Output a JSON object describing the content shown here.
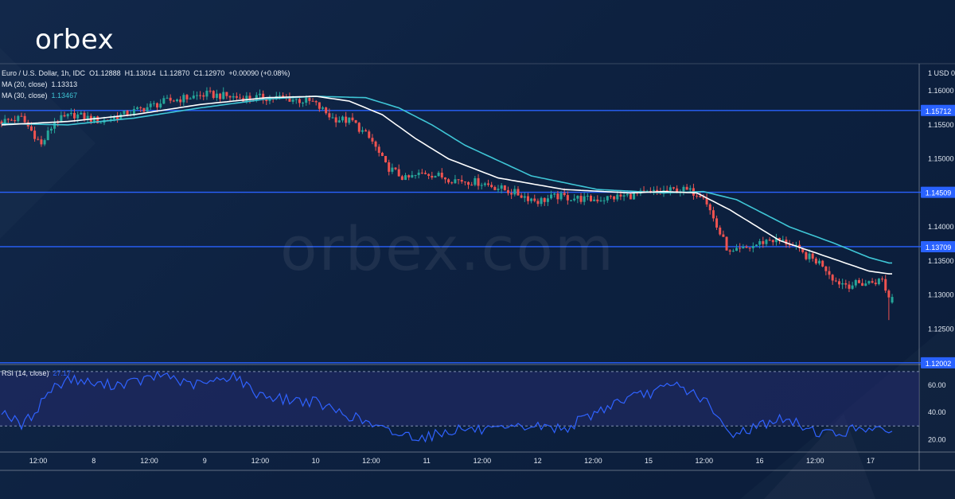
{
  "brand": {
    "logo_text": "orbex",
    "watermark_text": "orbex.com"
  },
  "legend": {
    "symbol_line": "Euro / U.S. Dollar, 1h, IDC",
    "open": "O1.12888",
    "high": "H1.13014",
    "low": "L1.12870",
    "close": "C1.12970",
    "change": "+0.00090 (+0.08%)",
    "ma20_label": "MA (20, close)",
    "ma20_value": "1.13313",
    "ma30_label": "MA (30, close)",
    "ma30_value": "1.13467",
    "rsi_label": "RSI (14, close)",
    "rsi_value": "27.17"
  },
  "colors": {
    "background": "#0e2240",
    "up_candle": "#26a69a",
    "down_candle": "#ef5350",
    "ma20": "#ffffff",
    "ma30": "#3fc6d6",
    "hline": "#2962ff",
    "rsi_line": "#2f62ff",
    "rsi_band": "#252c6e",
    "axis_text": "#dfe6f0"
  },
  "chart_data": {
    "type": "candlestick",
    "title": "Euro / U.S. Dollar, 1h, IDC",
    "currency_label": "1 USD 0",
    "ylim": [
      1.12,
      1.164
    ],
    "yticks": [
      "1.16000",
      "1.15500",
      "1.15000",
      "1.14000",
      "1.13500",
      "1.13000",
      "1.12500"
    ],
    "ytick_values": [
      1.16,
      1.155,
      1.15,
      1.14,
      1.135,
      1.13,
      1.125
    ],
    "xticks": [
      "12:00",
      "8",
      "12:00",
      "9",
      "12:00",
      "10",
      "12:00",
      "11",
      "12:00",
      "12",
      "12:00",
      "15",
      "12:00",
      "16",
      "12:00",
      "17"
    ],
    "horizontal_levels": [
      {
        "label": "1.15712",
        "value": 1.15712
      },
      {
        "label": "1.14509",
        "value": 1.14509
      },
      {
        "label": "1.13709",
        "value": 1.13709
      },
      {
        "label": "1.12002",
        "value": 1.12002
      }
    ],
    "price_anchors": [
      [
        0,
        1.1555
      ],
      [
        6,
        1.156
      ],
      [
        10,
        1.1535
      ],
      [
        12,
        1.152
      ],
      [
        16,
        1.1555
      ],
      [
        22,
        1.1565
      ],
      [
        30,
        1.1555
      ],
      [
        40,
        1.157
      ],
      [
        50,
        1.1585
      ],
      [
        62,
        1.1595
      ],
      [
        72,
        1.159
      ],
      [
        85,
        1.159
      ],
      [
        94,
        1.1583
      ],
      [
        100,
        1.156
      ],
      [
        106,
        1.1555
      ],
      [
        112,
        1.1525
      ],
      [
        116,
        1.149
      ],
      [
        122,
        1.147
      ],
      [
        128,
        1.148
      ],
      [
        136,
        1.147
      ],
      [
        145,
        1.1465
      ],
      [
        155,
        1.145
      ],
      [
        162,
        1.1438
      ],
      [
        168,
        1.1445
      ],
      [
        178,
        1.144
      ],
      [
        188,
        1.1445
      ],
      [
        196,
        1.145
      ],
      [
        205,
        1.1455
      ],
      [
        212,
        1.1448
      ],
      [
        216,
        1.14
      ],
      [
        220,
        1.136
      ],
      [
        226,
        1.137
      ],
      [
        232,
        1.1382
      ],
      [
        238,
        1.1376
      ],
      [
        242,
        1.136
      ],
      [
        248,
        1.1345
      ],
      [
        252,
        1.132
      ],
      [
        256,
        1.1315
      ],
      [
        262,
        1.1318
      ],
      [
        266,
        1.1322
      ],
      [
        268,
        1.1296
      ]
    ],
    "ma20_anchors": [
      [
        0,
        1.155
      ],
      [
        20,
        1.1555
      ],
      [
        40,
        1.1565
      ],
      [
        60,
        1.158
      ],
      [
        80,
        1.159
      ],
      [
        95,
        1.1592
      ],
      [
        105,
        1.1585
      ],
      [
        115,
        1.1565
      ],
      [
        125,
        1.153
      ],
      [
        135,
        1.15
      ],
      [
        150,
        1.1472
      ],
      [
        170,
        1.1455
      ],
      [
        190,
        1.145
      ],
      [
        200,
        1.1452
      ],
      [
        210,
        1.145
      ],
      [
        220,
        1.1425
      ],
      [
        235,
        1.138
      ],
      [
        250,
        1.1355
      ],
      [
        262,
        1.1335
      ],
      [
        268,
        1.1331
      ]
    ],
    "ma30_anchors": [
      [
        0,
        1.1552
      ],
      [
        20,
        1.155
      ],
      [
        40,
        1.156
      ],
      [
        60,
        1.1575
      ],
      [
        80,
        1.1588
      ],
      [
        95,
        1.1592
      ],
      [
        110,
        1.159
      ],
      [
        120,
        1.1575
      ],
      [
        130,
        1.155
      ],
      [
        140,
        1.152
      ],
      [
        160,
        1.1475
      ],
      [
        180,
        1.1455
      ],
      [
        200,
        1.145
      ],
      [
        212,
        1.1452
      ],
      [
        222,
        1.144
      ],
      [
        238,
        1.14
      ],
      [
        252,
        1.1375
      ],
      [
        262,
        1.1355
      ],
      [
        268,
        1.1347
      ]
    ],
    "last_candle": {
      "open": 1.12888,
      "high": 1.13014,
      "low": 1.1287,
      "close": 1.1297
    },
    "rsi": {
      "label": "RSI (14, close)",
      "value": 27.17,
      "ylim": [
        12,
        74
      ],
      "yticks": [
        "60.00",
        "40.00",
        "20.00"
      ],
      "ytick_values": [
        60,
        40,
        20
      ],
      "overbought": 70,
      "oversold": 30,
      "anchors": [
        [
          0,
          42
        ],
        [
          6,
          30
        ],
        [
          10,
          40
        ],
        [
          14,
          55
        ],
        [
          20,
          65
        ],
        [
          30,
          60
        ],
        [
          40,
          62
        ],
        [
          50,
          68
        ],
        [
          56,
          60
        ],
        [
          64,
          62
        ],
        [
          70,
          68
        ],
        [
          76,
          55
        ],
        [
          84,
          50
        ],
        [
          94,
          48
        ],
        [
          100,
          42
        ],
        [
          108,
          35
        ],
        [
          114,
          28
        ],
        [
          120,
          24
        ],
        [
          128,
          22
        ],
        [
          138,
          28
        ],
        [
          150,
          26
        ],
        [
          160,
          30
        ],
        [
          170,
          28
        ],
        [
          178,
          38
        ],
        [
          186,
          48
        ],
        [
          194,
          53
        ],
        [
          204,
          60
        ],
        [
          212,
          50
        ],
        [
          216,
          36
        ],
        [
          220,
          24
        ],
        [
          226,
          28
        ],
        [
          234,
          35
        ],
        [
          240,
          32
        ],
        [
          246,
          26
        ],
        [
          252,
          24
        ],
        [
          258,
          28
        ],
        [
          264,
          30
        ],
        [
          267,
          22
        ],
        [
          269,
          27
        ]
      ]
    }
  }
}
